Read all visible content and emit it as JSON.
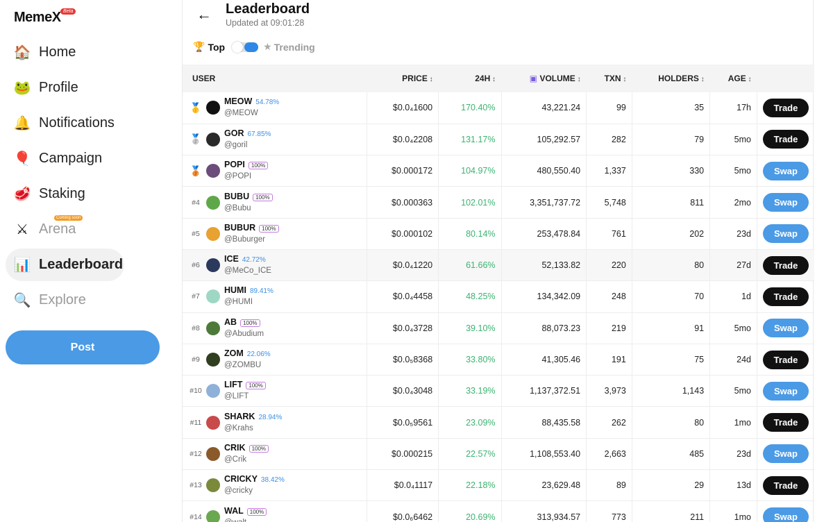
{
  "app": {
    "logo": "MemeX",
    "logo_badge": "Beta"
  },
  "sidebar": {
    "items": [
      {
        "label": "Home",
        "icon": "home-icon",
        "glyph": "🏠"
      },
      {
        "label": "Profile",
        "icon": "pepe-avatar-icon",
        "glyph": "🐸"
      },
      {
        "label": "Notifications",
        "icon": "bell-icon",
        "glyph": "🔔"
      },
      {
        "label": "Campaign",
        "icon": "balloon-icon",
        "glyph": "🎈"
      },
      {
        "label": "Staking",
        "icon": "steak-icon",
        "glyph": "🥩"
      },
      {
        "label": "Arena",
        "icon": "crossed-swords-icon",
        "glyph": "⚔",
        "tag": "Coming soon"
      },
      {
        "label": "Leaderboard",
        "icon": "leaderboard-icon",
        "glyph": "📊"
      },
      {
        "label": "Explore",
        "icon": "search-icon",
        "glyph": "🔍"
      }
    ],
    "post_label": "Post"
  },
  "header": {
    "title": "Leaderboard",
    "updated": "Updated at 09:01:28"
  },
  "toggle": {
    "top_label": "Top",
    "trending_label": "Trending"
  },
  "table": {
    "columns": {
      "user": "USER",
      "price": "PRICE",
      "change": "24H",
      "volume": "VOLUME",
      "txn": "TXN",
      "holders": "HOLDERS",
      "age": "AGE"
    },
    "rows": [
      {
        "rank": "",
        "medal": "🥇",
        "symbol": "MEOW",
        "pct": "54.78%",
        "badge": "",
        "handle": "@MEOW",
        "price": "$0.0₄1600",
        "change": "170.40%",
        "volume": "43,221.24",
        "txn": "99",
        "holders": "35",
        "age": "17h",
        "action": "Trade",
        "avatar_color": "#111111"
      },
      {
        "rank": "",
        "medal": "🥈",
        "symbol": "GOR",
        "pct": "67.85%",
        "badge": "",
        "handle": "@goril",
        "price": "$0.0₄2208",
        "change": "131.17%",
        "volume": "105,292.57",
        "txn": "282",
        "holders": "79",
        "age": "5mo",
        "action": "Trade",
        "avatar_color": "#2a2a2a"
      },
      {
        "rank": "",
        "medal": "🥉",
        "symbol": "POPI",
        "pct": "",
        "badge": "100%",
        "handle": "@POPI",
        "price": "$0.000172",
        "change": "104.97%",
        "volume": "480,550.40",
        "txn": "1,337",
        "holders": "330",
        "age": "5mo",
        "action": "Swap",
        "avatar_color": "#6b4c7a"
      },
      {
        "rank": "#4",
        "medal": "",
        "symbol": "BUBU",
        "pct": "",
        "badge": "100%",
        "handle": "@Bubu",
        "price": "$0.000363",
        "change": "102.01%",
        "volume": "3,351,737.72",
        "txn": "5,748",
        "holders": "811",
        "age": "2mo",
        "action": "Swap",
        "avatar_color": "#5fa84a"
      },
      {
        "rank": "#5",
        "medal": "",
        "symbol": "BUBUR",
        "pct": "",
        "badge": "100%",
        "handle": "@Buburger",
        "price": "$0.000102",
        "change": "80.14%",
        "volume": "253,478.84",
        "txn": "761",
        "holders": "202",
        "age": "23d",
        "action": "Swap",
        "avatar_color": "#e7a232"
      },
      {
        "rank": "#6",
        "medal": "",
        "symbol": "ICE",
        "pct": "42.72%",
        "badge": "",
        "handle": "@MeCo_ICE",
        "price": "$0.0₄1220",
        "change": "61.66%",
        "volume": "52,133.82",
        "txn": "220",
        "holders": "80",
        "age": "27d",
        "action": "Trade",
        "avatar_color": "#2b3a5c"
      },
      {
        "rank": "#7",
        "medal": "",
        "symbol": "HUMI",
        "pct": "89.41%",
        "badge": "",
        "handle": "@HUMI",
        "price": "$0.0₄4458",
        "change": "48.25%",
        "volume": "134,342.09",
        "txn": "248",
        "holders": "70",
        "age": "1d",
        "action": "Trade",
        "avatar_color": "#9ed8c5"
      },
      {
        "rank": "#8",
        "medal": "",
        "symbol": "AB",
        "pct": "",
        "badge": "100%",
        "handle": "@Abudium",
        "price": "$0.0₄3728",
        "change": "39.10%",
        "volume": "88,073.23",
        "txn": "219",
        "holders": "91",
        "age": "5mo",
        "action": "Swap",
        "avatar_color": "#4d7a3a"
      },
      {
        "rank": "#9",
        "medal": "",
        "symbol": "ZOM",
        "pct": "22.06%",
        "badge": "",
        "handle": "@ZOMBU",
        "price": "$0.0₅8368",
        "change": "33.80%",
        "volume": "41,305.46",
        "txn": "191",
        "holders": "75",
        "age": "24d",
        "action": "Trade",
        "avatar_color": "#2f3f1f"
      },
      {
        "rank": "#10",
        "medal": "",
        "symbol": "LIFT",
        "pct": "",
        "badge": "100%",
        "handle": "@LIFT",
        "price": "$0.0₄3048",
        "change": "33.19%",
        "volume": "1,137,372.51",
        "txn": "3,973",
        "holders": "1,143",
        "age": "5mo",
        "action": "Swap",
        "avatar_color": "#8fb0d8"
      },
      {
        "rank": "#11",
        "medal": "",
        "symbol": "SHARK",
        "pct": "28.94%",
        "badge": "",
        "handle": "@Krahs",
        "price": "$0.0₅9561",
        "change": "23.09%",
        "volume": "88,435.58",
        "txn": "262",
        "holders": "80",
        "age": "1mo",
        "action": "Trade",
        "avatar_color": "#c94a4a"
      },
      {
        "rank": "#12",
        "medal": "",
        "symbol": "CRIK",
        "pct": "",
        "badge": "100%",
        "handle": "@Crik",
        "price": "$0.000215",
        "change": "22.57%",
        "volume": "1,108,553.40",
        "txn": "2,663",
        "holders": "485",
        "age": "23d",
        "action": "Swap",
        "avatar_color": "#8a5a2a"
      },
      {
        "rank": "#13",
        "medal": "",
        "symbol": "CRICKY",
        "pct": "38.42%",
        "badge": "",
        "handle": "@cricky",
        "price": "$0.0₄1117",
        "change": "22.18%",
        "volume": "23,629.48",
        "txn": "89",
        "holders": "29",
        "age": "13d",
        "action": "Trade",
        "avatar_color": "#7a8a3a"
      },
      {
        "rank": "#14",
        "medal": "",
        "symbol": "WAL",
        "pct": "",
        "badge": "100%",
        "handle": "@walt",
        "price": "$0.0₆6462",
        "change": "20.69%",
        "volume": "313,934.57",
        "txn": "773",
        "holders": "211",
        "age": "1mo",
        "action": "Swap",
        "avatar_color": "#6aa84f"
      }
    ]
  },
  "colors": {
    "accent": "#4a9ae5",
    "gain": "#3cb371",
    "trade_button": "#111111"
  }
}
